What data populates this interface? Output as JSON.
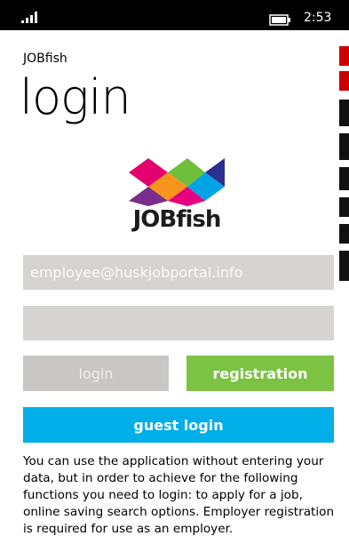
{
  "status_bar": {
    "time": "2:53"
  },
  "app": {
    "name": "JOBfish"
  },
  "page": {
    "title": "login"
  },
  "logo": {
    "text": "JOBfish"
  },
  "form": {
    "email_placeholder": "employee@huskjobportal.info",
    "password_placeholder": ""
  },
  "buttons": {
    "login": "login",
    "registration": "registration",
    "guest_login": "guest login"
  },
  "info_text": "You can use the application without entering your data, but in order to achieve for the following functions you need to login: to apply for a job, online saving search options. Employer registration is required for use as an employer.",
  "colors": {
    "registration": "#7cc243",
    "guest": "#00aee8",
    "field": "#d6d3d3"
  }
}
